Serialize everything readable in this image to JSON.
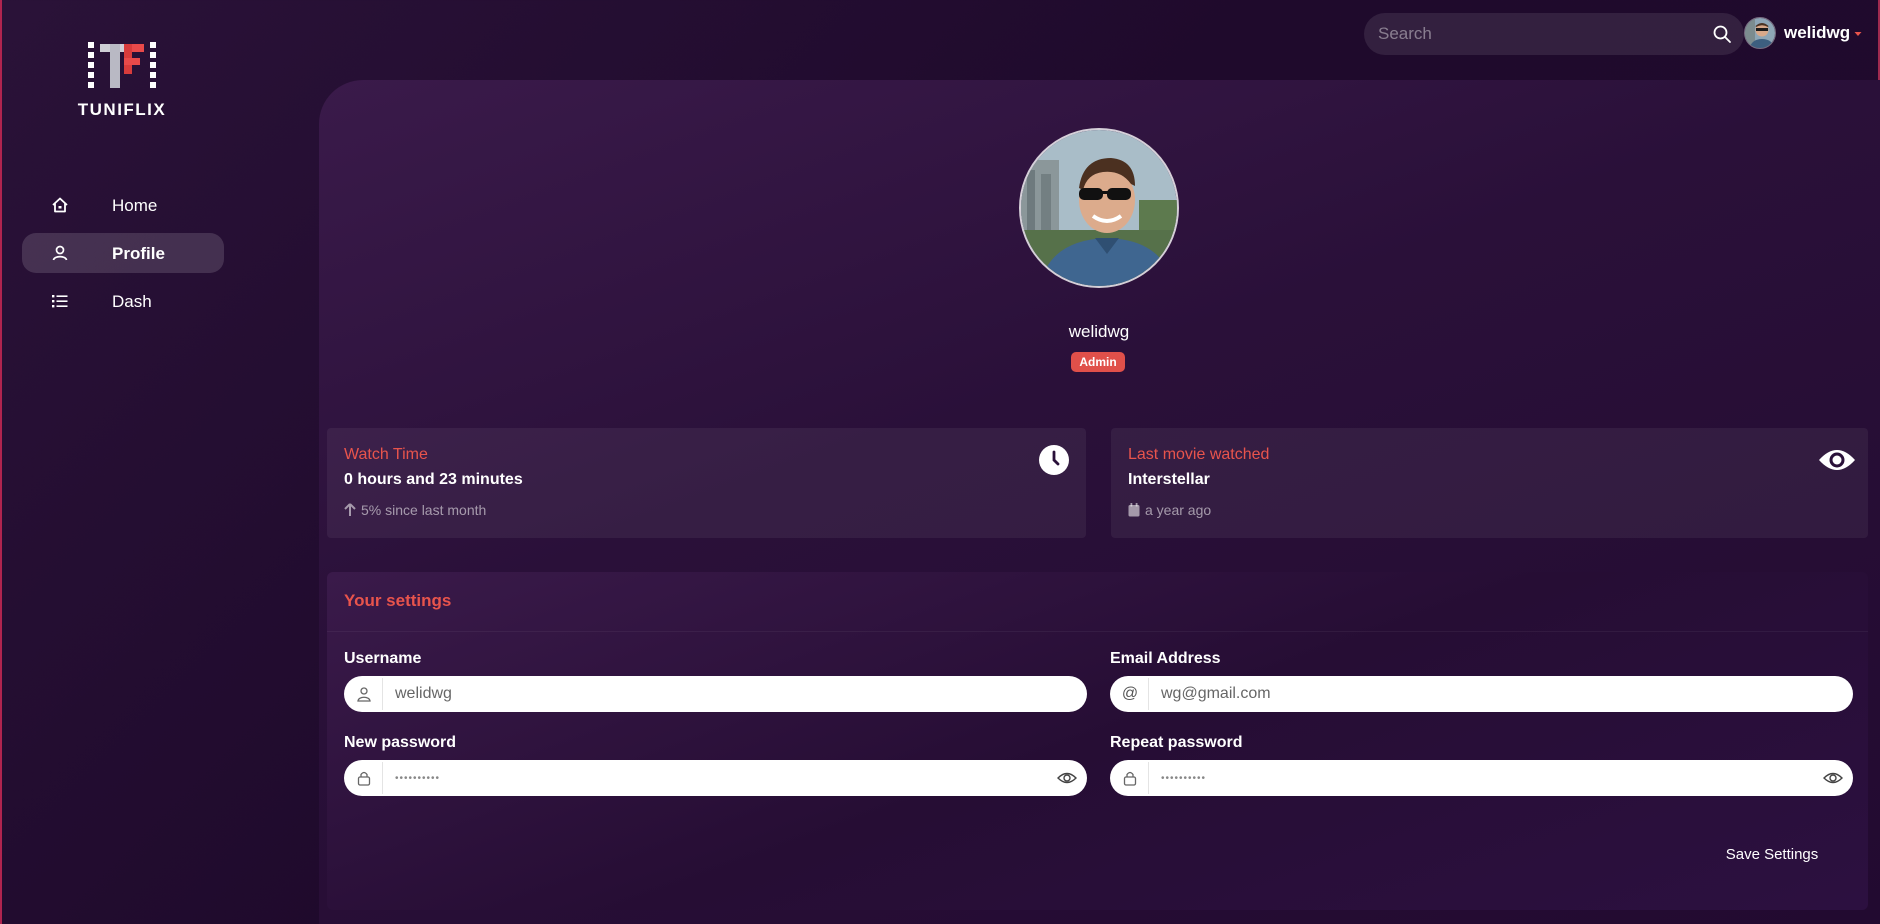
{
  "app": {
    "logo_text": "TUNIFLIX"
  },
  "sidebar": {
    "items": [
      {
        "label": "Home",
        "icon": "home-icon",
        "active": false
      },
      {
        "label": "Profile",
        "icon": "user-icon",
        "active": true
      },
      {
        "label": "Dash",
        "icon": "list-icon",
        "active": false
      }
    ]
  },
  "topbar": {
    "search_placeholder": "Search",
    "username": "welidwg"
  },
  "profile": {
    "name": "welidwg",
    "role": "Admin"
  },
  "stats": {
    "watch_time": {
      "title": "Watch Time",
      "value": "0 hours and 23 minutes",
      "sub": "5% since last month",
      "icon": "clock-icon",
      "sub_icon": "arrow-up-icon"
    },
    "last_movie": {
      "title": "Last movie watched",
      "value": "Interstellar",
      "sub": "a year ago",
      "icon": "eye-icon",
      "sub_icon": "calendar-icon"
    }
  },
  "settings": {
    "title": "Your settings",
    "username_label": "Username",
    "username_value": "welidwg",
    "email_label": "Email Address",
    "email_value": "wg@gmail.com",
    "new_password_label": "New password",
    "new_password_value": "••••••••••",
    "repeat_password_label": "Repeat password",
    "repeat_password_value": "••••••••••",
    "save_label": "Save Settings"
  },
  "colors": {
    "accent": "#e8544c",
    "badge": "#e0504a",
    "background": "#200a2e",
    "panel": "#2a1039"
  }
}
